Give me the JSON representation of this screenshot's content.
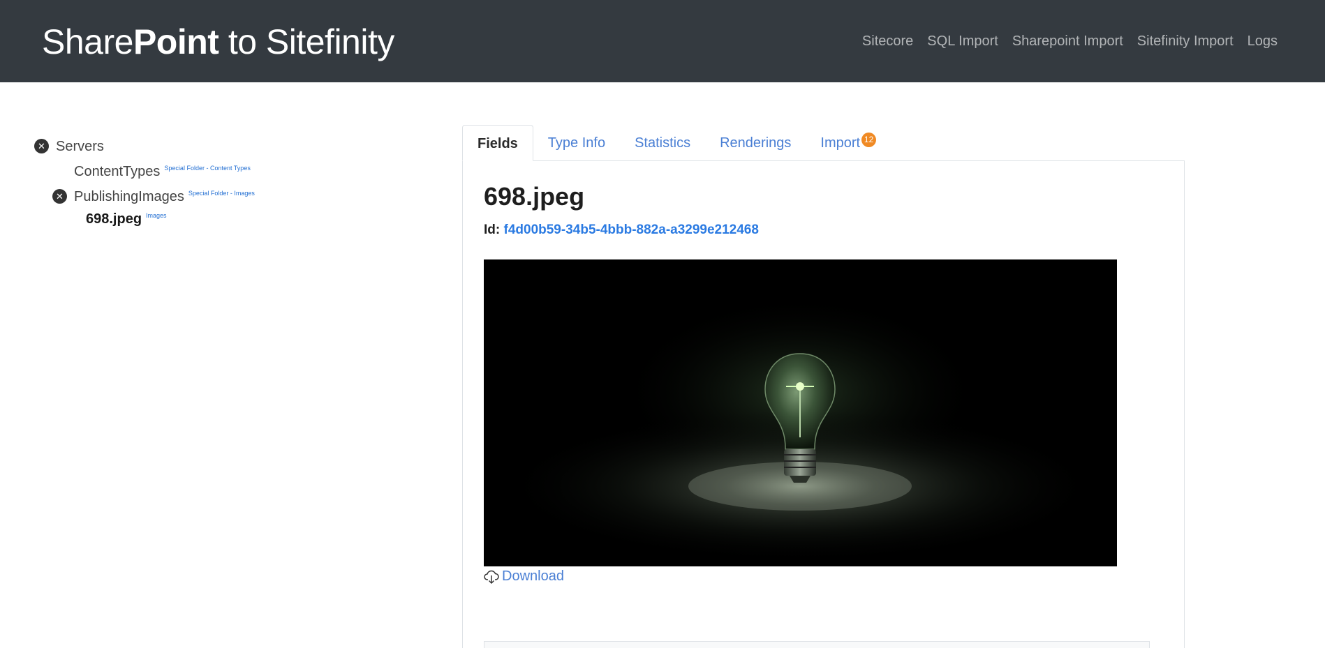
{
  "header": {
    "brand_pre": "Share",
    "brand_bold": "Point",
    "brand_post": " to Sitefinity",
    "nav": [
      "Sitecore",
      "SQL Import",
      "Sharepoint Import",
      "Sitefinity Import",
      "Logs"
    ]
  },
  "tree": {
    "servers": {
      "label": "Servers"
    },
    "content_types": {
      "label": "ContentTypes",
      "tag": "Special Folder - Content Types"
    },
    "publishing_images": {
      "label": "PublishingImages",
      "tag": "Special Folder - Images"
    },
    "file": {
      "label": "698.jpeg",
      "tag": "Images"
    }
  },
  "tabs": {
    "fields": "Fields",
    "type_info": "Type Info",
    "statistics": "Statistics",
    "renderings": "Renderings",
    "import": "Import",
    "import_badge": "12"
  },
  "item": {
    "title": "698.jpeg",
    "id_label": "Id:",
    "id_value": "f4d00b59-34b5-4bbb-882a-a3299e212468",
    "download_label": "Download"
  },
  "colors": {
    "navbar": "#343a40",
    "link": "#4a7fd4",
    "badge": "#f08a24"
  }
}
